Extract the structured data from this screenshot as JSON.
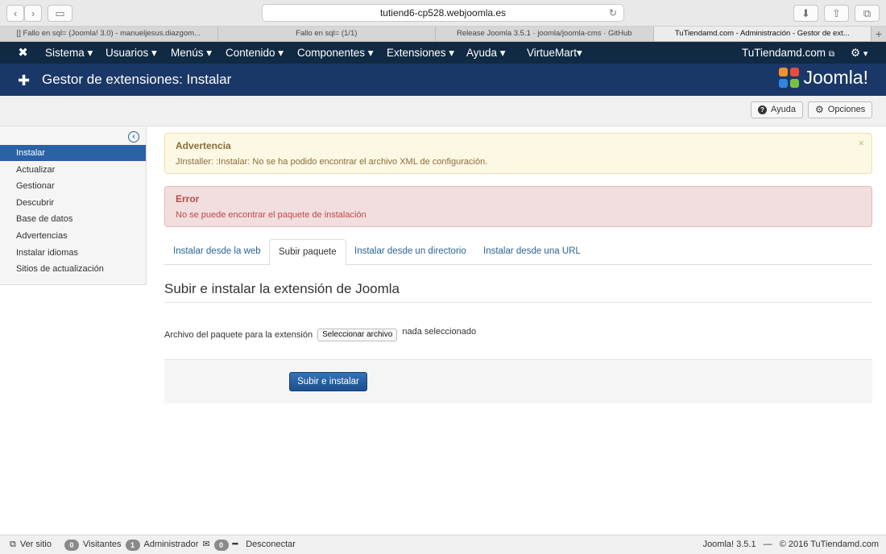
{
  "browser": {
    "url": "tutiend6-cp528.webjoomla.es",
    "tabs": [
      {
        "label": "[] Fallo en sql= (Joomla! 3.0) - manueljesus.diazgom..."
      },
      {
        "label": "Fallo en sql= (1/1)"
      },
      {
        "label": "Release Joomla 3.5.1 · joomla/joomla-cms · GitHub"
      },
      {
        "label": "TuTiendamd.com - Administración - Gestor de ext..."
      }
    ]
  },
  "menu": {
    "items": [
      {
        "label": "Sistema ▾"
      },
      {
        "label": "Usuarios ▾"
      },
      {
        "label": "Menús ▾"
      },
      {
        "label": "Contenido ▾"
      },
      {
        "label": "Componentes ▾"
      },
      {
        "label": "Extensiones ▾"
      },
      {
        "label": "Ayuda ▾"
      },
      {
        "label": "VirtueMart▾"
      }
    ],
    "site": "TuTiendamd.com",
    "settings_caret": "▾"
  },
  "header": {
    "title": "Gestor de extensiones: Instalar",
    "brand": "Joomla!"
  },
  "toolbar": {
    "help_label": "Ayuda",
    "options_label": "Opciones"
  },
  "sidebar": {
    "items": [
      {
        "label": "Instalar"
      },
      {
        "label": "Actualizar"
      },
      {
        "label": "Gestionar"
      },
      {
        "label": "Descubrir"
      },
      {
        "label": "Base de datos"
      },
      {
        "label": "Advertencias"
      },
      {
        "label": "Instalar idiomas"
      },
      {
        "label": "Sitios de actualización"
      }
    ]
  },
  "alerts": {
    "warning": {
      "heading": "Advertencia",
      "message": "JInstaller: :Instalar: No se ha podido encontrar el archivo XML de configuración."
    },
    "error": {
      "heading": "Error",
      "message": "No se puede encontrar el paquete de instalación"
    }
  },
  "tabs": [
    {
      "label": "Instalar desde la web"
    },
    {
      "label": "Subir paquete"
    },
    {
      "label": "Instalar desde un directorio"
    },
    {
      "label": "Instalar desde una URL"
    }
  ],
  "upload": {
    "title": "Subir e instalar la extensión de Joomla",
    "file_label": "Archivo del paquete para la extensión",
    "choose_button": "Seleccionar archivo",
    "file_status": "nada seleccionado",
    "submit_label": "Subir e instalar"
  },
  "footer": {
    "view_site": "Ver sitio",
    "visitors_count": "0",
    "visitors_label": "Visitantes",
    "admins_count": "1",
    "admins_label": "Administrador",
    "messages_count": "0",
    "logout": "Desconectar",
    "version": "Joomla! 3.5.1",
    "separator": "—",
    "copyright": "© 2016 TuTiendamd.com"
  },
  "colors": {
    "navbar": "#102a43",
    "header": "#1a3867",
    "active_sidebar": "#2b61a5",
    "link": "#2a6496"
  }
}
